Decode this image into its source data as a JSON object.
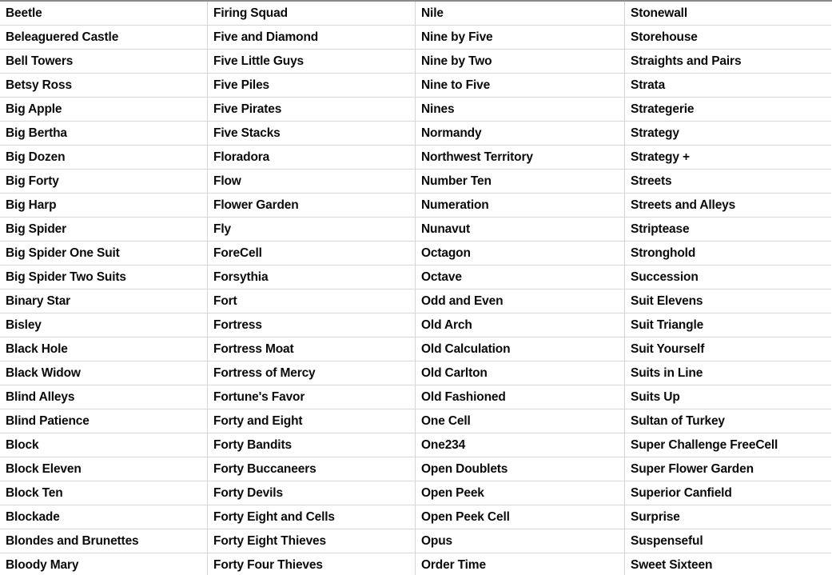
{
  "table": {
    "row_count": 24,
    "column_count": 4,
    "colors": {
      "text": "#0a0a0a",
      "row_separator": "#d7d7d7",
      "column_separator": "#d4d4d4",
      "top_border": "#8a8a8a",
      "background": "#ffffff"
    },
    "columns": [
      {
        "index": 0,
        "cells": [
          "Beetle",
          "Beleaguered Castle",
          "Bell Towers",
          "Betsy Ross",
          "Big Apple",
          "Big Bertha",
          "Big Dozen",
          "Big Forty",
          "Big Harp",
          "Big Spider",
          "Big Spider One Suit",
          "Big Spider Two Suits",
          "Binary Star",
          "Bisley",
          "Black Hole",
          "Black Widow",
          "Blind Alleys",
          "Blind Patience",
          "Block",
          "Block Eleven",
          "Block Ten",
          "Blockade",
          "Blondes and Brunettes",
          "Bloody Mary"
        ]
      },
      {
        "index": 1,
        "cells": [
          "Firing Squad",
          "Five and Diamond",
          "Five Little Guys",
          "Five Piles",
          "Five Pirates",
          "Five Stacks",
          "Floradora",
          "Flow",
          "Flower Garden",
          "Fly",
          "ForeCell",
          "Forsythia",
          "Fort",
          "Fortress",
          "Fortress Moat",
          "Fortress of Mercy",
          "Fortune's Favor",
          "Forty and Eight",
          "Forty Bandits",
          "Forty Buccaneers",
          "Forty Devils",
          "Forty Eight and Cells",
          "Forty Eight Thieves",
          "Forty Four Thieves"
        ]
      },
      {
        "index": 2,
        "cells": [
          "Nile",
          "Nine by Five",
          "Nine by Two",
          "Nine to Five",
          "Nines",
          "Normandy",
          "Northwest Territory",
          "Number Ten",
          "Numeration",
          "Nunavut",
          "Octagon",
          "Octave",
          "Odd and Even",
          "Old Arch",
          "Old Calculation",
          "Old Carlton",
          "Old Fashioned",
          "One Cell",
          "One234",
          "Open Doublets",
          "Open Peek",
          "Open Peek Cell",
          "Opus",
          "Order Time"
        ]
      },
      {
        "index": 3,
        "cells": [
          "Stonewall",
          "Storehouse",
          "Straights and Pairs",
          "Strata",
          "Strategerie",
          "Strategy",
          "Strategy +",
          "Streets",
          "Streets and Alleys",
          "Striptease",
          "Stronghold",
          "Succession",
          "Suit Elevens",
          "Suit Triangle",
          "Suit Yourself",
          "Suits in Line",
          "Suits Up",
          "Sultan of Turkey",
          "Super Challenge FreeCell",
          "Super Flower Garden",
          "Superior Canfield",
          "Surprise",
          "Suspenseful",
          "Sweet Sixteen"
        ]
      }
    ]
  }
}
